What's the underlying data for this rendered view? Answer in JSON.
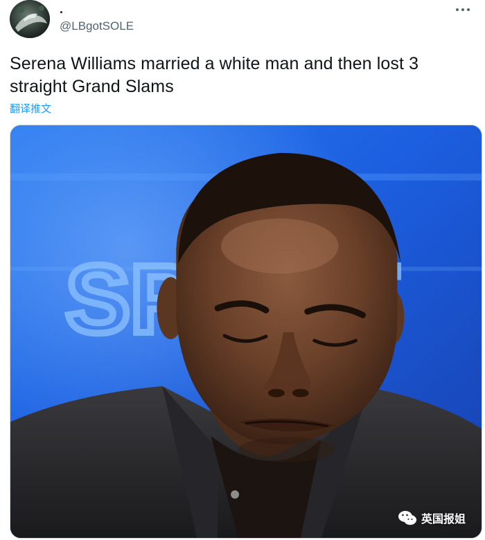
{
  "tweet": {
    "display_name": ".",
    "handle": "@LBgotSOLE",
    "text": "Serena Williams married a white man and then lost 3 straight Grand Slams",
    "translate_label": "翻译推文"
  },
  "media": {
    "background_text": "SPORT",
    "description_icon": "photo"
  },
  "watermark": {
    "label": "英国报姐",
    "icon": "wechat-icon"
  },
  "colors": {
    "text": "#0f1419",
    "secondary": "#536471",
    "link": "#1d9bf0",
    "border": "#cfd9de"
  }
}
